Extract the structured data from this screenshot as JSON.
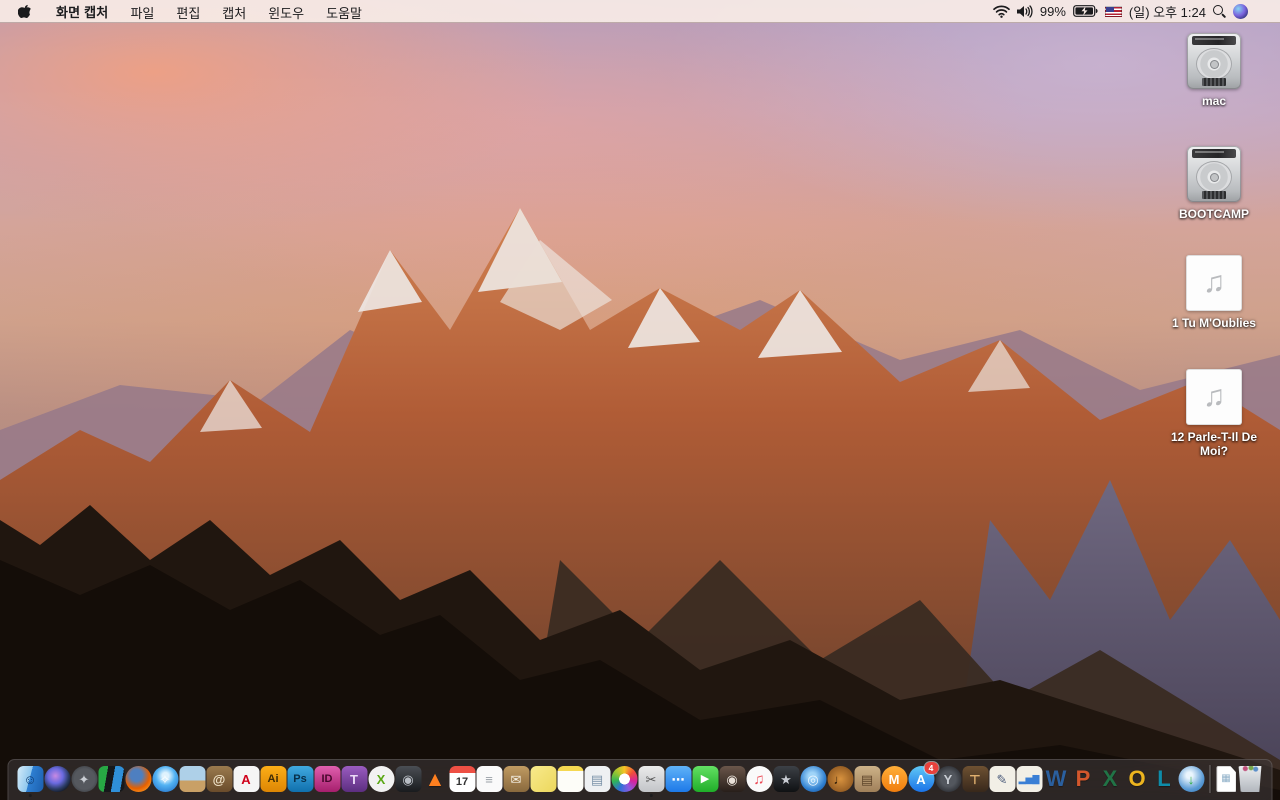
{
  "menu_bar": {
    "app_name": "화면 캡처",
    "menus": [
      {
        "name": "file",
        "label": "파일"
      },
      {
        "name": "edit",
        "label": "편집"
      },
      {
        "name": "capture",
        "label": "캡처"
      },
      {
        "name": "window",
        "label": "윈도우"
      },
      {
        "name": "help",
        "label": "도움말"
      }
    ],
    "status": {
      "battery_percent": "99%",
      "battery_charging": true,
      "input_source": "US",
      "clock": "(일) 오후 1:24"
    }
  },
  "desktop": {
    "icons": [
      {
        "name": "drive-mac",
        "type": "drive",
        "label": "mac"
      },
      {
        "name": "drive-bootcamp",
        "type": "drive",
        "label": "BOOTCAMP"
      },
      {
        "name": "audio-file-1",
        "type": "audio",
        "label": "1 Tu M'Oublies",
        "glyph": "♫"
      },
      {
        "name": "audio-file-12",
        "type": "audio",
        "label": "12 Parle-T-Il De Moi?",
        "glyph": "♫"
      }
    ]
  },
  "dock": {
    "items": [
      {
        "name": "finder",
        "shape": "rounded",
        "bg": "linear-gradient(105deg,#d7ecf9 0%,#8ec7ee 47%,#2e7fd2 47%,#1b5fae 100%)",
        "glyph": "☺",
        "fg": "#123c6e",
        "running": true
      },
      {
        "name": "siri",
        "shape": "circle",
        "bg": "radial-gradient(circle at 42% 38%,#c88ae2 0%,#6a6ae0 34%,#2b3c66 60%,#0f1217 82%)",
        "glyph": ""
      },
      {
        "name": "launchpad",
        "shape": "circle",
        "bg": "radial-gradient(circle,#55585e 55%,#2c2f34 100%)",
        "glyph": "✦",
        "fg": "#c9cdd3"
      },
      {
        "name": "mission-control",
        "shape": "rounded",
        "bg": "linear-gradient(100deg,#27a844 0 32%,#16181b 32% 55%,#2f8fd8 55% 85%,#16181b 85%)",
        "glyph": ""
      },
      {
        "name": "firefox",
        "shape": "circle",
        "bg": "radial-gradient(circle at 42% 36%,#4e7fc0 0 26%,#e66000 58%,#ffa62b 92%)",
        "glyph": ""
      },
      {
        "name": "safari",
        "shape": "circle",
        "bg": "radial-gradient(circle at 50% 38%,#dff2fd 0 16%,#52b2f3 46%,#1b66c1 100%)",
        "glyph": "✧",
        "fg": "#ffffff"
      },
      {
        "name": "preview",
        "shape": "rounded",
        "bg": "linear-gradient(180deg,#aed0e8 56%,#c9a066 56%)",
        "glyph": ""
      },
      {
        "name": "contacts",
        "shape": "rounded",
        "bg": "linear-gradient(180deg,#9a7a4e,#6a4c2b)",
        "glyph": "@",
        "fg": "#f0e3c9"
      },
      {
        "name": "acrobat",
        "shape": "rounded",
        "bg": "#f5f5f5",
        "glyph": "A",
        "fg": "#d0021b"
      },
      {
        "name": "illustrator",
        "shape": "rounded",
        "bg": "linear-gradient(180deg,#fcae17,#dd8604)",
        "glyph": "Ai",
        "fg": "#3e2c05",
        "fs": 11
      },
      {
        "name": "photoshop",
        "shape": "rounded",
        "bg": "linear-gradient(180deg,#40a9e0,#1070ad)",
        "glyph": "Ps",
        "fg": "#07304a",
        "fs": 11
      },
      {
        "name": "indesign",
        "shape": "rounded",
        "bg": "linear-gradient(180deg,#e05fae,#a61f6d)",
        "glyph": "ID",
        "fg": "#47072c",
        "fs": 11
      },
      {
        "name": "toast",
        "shape": "rounded",
        "bg": "linear-gradient(180deg,#9a5cc0,#5c2e80)",
        "glyph": "T",
        "fg": "#ead9f6"
      },
      {
        "name": "xee",
        "shape": "circle",
        "bg": "#f2f2f2",
        "glyph": "X",
        "fg": "#5aa814"
      },
      {
        "name": "disk-utility-app",
        "shape": "rounded",
        "bg": "linear-gradient(180deg,#4a4e54,#191b1e)",
        "glyph": "◉",
        "fg": "#b9bec5"
      },
      {
        "name": "vlc",
        "shape": "plain",
        "glyph": "▲",
        "fg": "#ff7f1f",
        "fs": 21
      },
      {
        "name": "calendar",
        "shape": "rounded",
        "cls": "cal",
        "bg": "linear-gradient(180deg,#ee5044 27%,#ffffff 27%)",
        "glyph": "17",
        "fg": "#333333",
        "fs": 11
      },
      {
        "name": "reminders",
        "shape": "rounded",
        "bg": "#fafafa",
        "glyph": "≡",
        "fg": "#9aa0a6"
      },
      {
        "name": "archive-box",
        "shape": "rounded",
        "bg": "linear-gradient(180deg,#c09a62,#89693d)",
        "glyph": "✉",
        "fg": "#f5f0e4"
      },
      {
        "name": "stickies",
        "shape": "rounded",
        "bg": "linear-gradient(135deg,#f8ea8c,#ecd75c)",
        "glyph": ""
      },
      {
        "name": "notes",
        "shape": "rounded",
        "bg": "linear-gradient(180deg,#f5d851 20%,#fdfdf8 20%)",
        "glyph": ""
      },
      {
        "name": "documents-app",
        "shape": "rounded",
        "bg": "#eef0f2",
        "glyph": "▤",
        "fg": "#7a92a8"
      },
      {
        "name": "photos",
        "shape": "circle",
        "bg": "radial-gradient(circle,#ffffff 0 29%,transparent 30%),conic-gradient(#f7c325,#ef4e3a,#d6219c,#8b5ae0,#2f6fd8,#2fb457,#9ac431,#f7c325)",
        "glyph": ""
      },
      {
        "name": "grab",
        "shape": "rounded",
        "bg": "linear-gradient(180deg,#ebebeb,#c2c4c8)",
        "glyph": "✂",
        "fg": "#555555",
        "running": true
      },
      {
        "name": "messages",
        "shape": "rounded",
        "bg": "linear-gradient(180deg,#5fb2f8,#1d79e8)",
        "glyph": "⋯",
        "fg": "#ffffff"
      },
      {
        "name": "facetime",
        "shape": "rounded",
        "bg": "linear-gradient(180deg,#63e063,#1fae29)",
        "glyph": "▶",
        "fg": "#ffffff",
        "fs": 11
      },
      {
        "name": "photo-booth",
        "shape": "rounded",
        "bg": "linear-gradient(180deg,#6a564a,#281f1a)",
        "glyph": "◉",
        "fg": "#e9e1d9"
      },
      {
        "name": "itunes",
        "shape": "circle",
        "bg": "#fafafa",
        "glyph": "♫",
        "fg": "#ec4b57",
        "fs": 15
      },
      {
        "name": "imovie",
        "shape": "rounded",
        "bg": "linear-gradient(180deg,#3c4046,#0f1113)",
        "glyph": "★",
        "fg": "#c9cdd4"
      },
      {
        "name": "dvd-player",
        "shape": "circle",
        "bg": "radial-gradient(circle at 45% 40%,#9fd4f8 0 18%,#2f7fd0 62%,#164a8c 100%)",
        "glyph": "◎",
        "fg": "#eaf5ff"
      },
      {
        "name": "garageband",
        "shape": "circle",
        "bg": "radial-gradient(circle,#d8923e,#7c4919)",
        "glyph": "♩",
        "fg": "#2e1c08"
      },
      {
        "name": "journal-app",
        "shape": "rounded",
        "bg": "linear-gradient(180deg,#cdb288,#a0805a)",
        "glyph": "▤",
        "fg": "#5e452a"
      },
      {
        "name": "ibooks",
        "shape": "circle",
        "bg": "linear-gradient(180deg,#ffae38,#f07d0e)",
        "glyph": "M",
        "fg": "#ffffff"
      },
      {
        "name": "app-store",
        "shape": "circle",
        "bg": "linear-gradient(180deg,#5fc7f5,#1a73e8)",
        "glyph": "A",
        "fg": "#ffffff",
        "badge": "4"
      },
      {
        "name": "steam",
        "shape": "circle",
        "bg": "radial-gradient(circle,#53575e 40%,#15161a 100%)",
        "glyph": "Y",
        "fg": "#c9cdd3"
      },
      {
        "name": "keynote",
        "shape": "rounded",
        "bg": "linear-gradient(180deg,#6e5132,#38281b)",
        "glyph": "⊤",
        "fg": "#e0b06f"
      },
      {
        "name": "pages-09",
        "shape": "rounded",
        "bg": "#f2efe6",
        "glyph": "✎",
        "fg": "#4a5a7a"
      },
      {
        "name": "numbers-09",
        "shape": "rounded",
        "bg": "#f2efe6",
        "glyph": "▂▅▇",
        "fg": "#3a7fd5",
        "fs": 9
      },
      {
        "name": "word",
        "shape": "plain",
        "glyph": "W",
        "fg": "#2b5f9e",
        "fs": 22
      },
      {
        "name": "powerpoint",
        "shape": "plain",
        "glyph": "P",
        "fg": "#d4572c",
        "fs": 22
      },
      {
        "name": "excel",
        "shape": "plain",
        "glyph": "X",
        "fg": "#217346",
        "fs": 22
      },
      {
        "name": "outlook",
        "shape": "plain",
        "glyph": "O",
        "fg": "#edb41f",
        "fs": 22
      },
      {
        "name": "lync",
        "shape": "plain",
        "glyph": "L",
        "fg": "#0e8ba8",
        "fs": 22
      },
      {
        "name": "downloader",
        "shape": "circle",
        "bg": "radial-gradient(circle at 42% 36%,#eaf5fd 0 14%,#5b9bd5 62%,#2a6fb0 100%)",
        "glyph": "↓",
        "fg": "#2fae3f"
      },
      {
        "name": "divider",
        "type": "divider"
      },
      {
        "name": "document-file",
        "shape": "doc",
        "bg": "#ffffff",
        "glyph": "▦",
        "fg": "#8fb0c8",
        "fs": 10
      },
      {
        "name": "trash",
        "shape": "trash",
        "bg": "radial-gradient(circle at 30% 10%,#c0507a 0 2px,transparent 3px),radial-gradient(circle at 52% 7%,#76a84f 0 2px,transparent 3px),radial-gradient(circle at 70% 12%,#5b8fc9 0 2px,transparent 3px),linear-gradient(180deg,#eceef0,#b2b7bd)",
        "glyph": ""
      }
    ]
  }
}
